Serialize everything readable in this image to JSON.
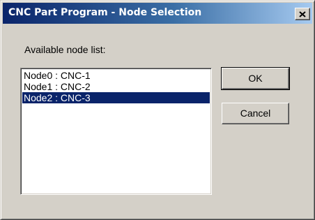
{
  "window": {
    "title": "CNC Part Program - Node Selection"
  },
  "dialog": {
    "list_label": "Available node list:",
    "nodes": [
      {
        "label": "Node0 : CNC-1",
        "selected": false
      },
      {
        "label": "Node1 : CNC-2",
        "selected": false
      },
      {
        "label": "Node2 : CNC-3",
        "selected": true
      }
    ],
    "ok_label": "OK",
    "cancel_label": "Cancel"
  },
  "colors": {
    "selection_bg": "#0a246a",
    "face": "#d4d0c8",
    "title_start": "#0a246a",
    "title_end": "#a6caf0"
  },
  "icons": {
    "close": "close-icon"
  }
}
